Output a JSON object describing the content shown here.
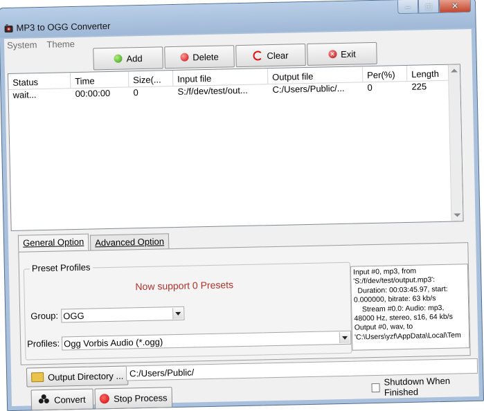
{
  "window": {
    "title": "MP3 to OGG Converter",
    "app_icon": "speaker-mp3-icon",
    "caption": {
      "minimize": "–",
      "maximize": "□",
      "close": "✕"
    }
  },
  "menu": {
    "items": [
      "System",
      "Theme"
    ]
  },
  "toolbar": {
    "add_label": "Add",
    "delete_label": "Delete",
    "clear_label": "Clear",
    "exit_label": "Exit"
  },
  "file_list": {
    "columns": [
      "Status",
      "Time",
      "Size(...",
      "Input file",
      "Output file",
      "Per(%)",
      "Length"
    ],
    "rows": [
      {
        "status": "wait...",
        "time": "00:00:00",
        "size": "0",
        "input": "S:/f/dev/test/out...",
        "output": "C:/Users/Public/...",
        "per": "0",
        "length": "225"
      }
    ]
  },
  "tabs": {
    "general": "General Option",
    "advanced": "Advanced Option",
    "active": "general"
  },
  "general": {
    "preset_group_label": "Preset Profiles",
    "presets_message": "Now support 0 Presets",
    "group_label": "Group:",
    "group_value": "OGG",
    "profiles_label": "Profiles:",
    "profiles_value": "Ogg Vorbis Audio (*.ogg)",
    "info_text": "Input #0, mp3, from\n'S:/f/dev/test/output.mp3':\n  Duration: 00:03:45.97, start:\n0.000000, bitrate: 63 kb/s\n    Stream #0.0: Audio: mp3,\n48000 Hz, stereo, s16, 64 kb/s\nOutput #0, wav, to\n'C:\\Users\\yzf\\AppData\\Local\\Tem"
  },
  "output": {
    "button_label": "Output Directory ...",
    "path": "C:/Users/Public/"
  },
  "actions": {
    "convert_label": "Convert",
    "stop_label": "Stop Process",
    "shutdown_label": "Shutdown When Finished",
    "shutdown_checked": false
  },
  "colors": {
    "presets_message": "#b3302a",
    "window_frame": "#a9c0dc",
    "close_button": "#c4452c"
  }
}
